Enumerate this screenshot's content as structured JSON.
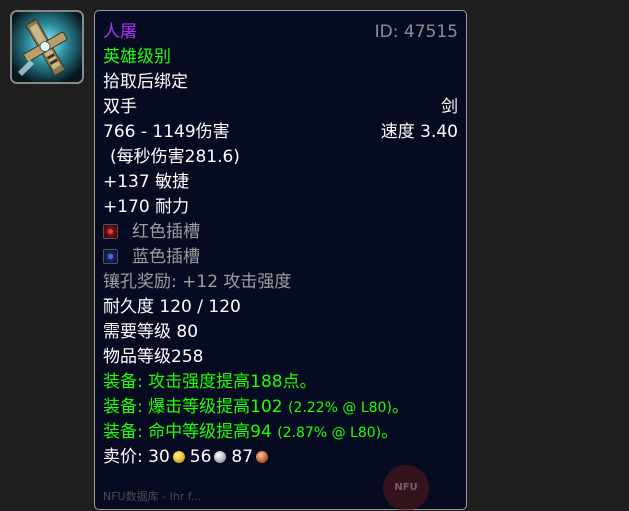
{
  "item": {
    "name": "人屠",
    "id_label": "ID: 47515",
    "quality": "英雄级别",
    "bind": "拾取后绑定",
    "slot": "双手",
    "type": "剑",
    "damage": "766 - 1149伤害",
    "speed": "速度 3.40",
    "dps": "(每秒伤害281.6)",
    "stats": [
      "+137 敏捷",
      "+170 耐力"
    ],
    "sockets": [
      {
        "color": "red",
        "label": "红色插槽"
      },
      {
        "color": "blue",
        "label": "蓝色插槽"
      }
    ],
    "socket_bonus": "镶孔奖励: +12 攻击强度",
    "durability": "耐久度 120 / 120",
    "required_level": "需要等级 80",
    "item_level": "物品等级258",
    "equips": [
      {
        "prefix": "装备:",
        "text": "攻击强度提高188点。",
        "rating": "",
        "suffix": ""
      },
      {
        "prefix": "装备:",
        "text": "爆击等级提高102",
        "rating": "(2.22% @ L80)",
        "suffix": "。"
      },
      {
        "prefix": "装备:",
        "text": "命中等级提高94",
        "rating": "(2.87% @ L80)",
        "suffix": "。"
      }
    ],
    "sell_price": {
      "label": "卖价:",
      "gold": "30",
      "silver": "56",
      "copper": "87"
    }
  },
  "icon": "sword-hilt-icon",
  "watermark_text": "NFU",
  "footer_text": "NFU数据库 - Ihr f...",
  "colors": {
    "name": "#a335ee",
    "quality": "#1eff00",
    "grey": "#9d9d9d",
    "tooltip_bg": "#070b22",
    "page_bg": "#1f1f1f"
  }
}
